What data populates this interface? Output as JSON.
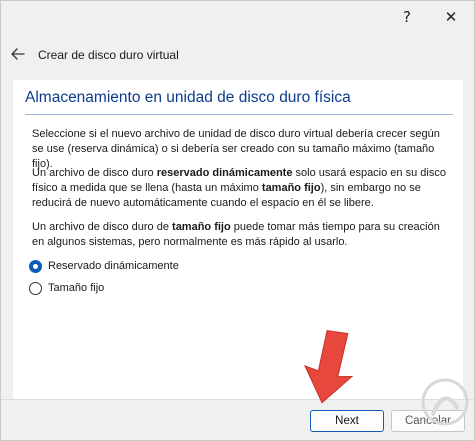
{
  "window": {
    "help_label": "?",
    "close_label": "✕"
  },
  "wizard": {
    "title": "Crear de disco duro virtual",
    "back_icon": "back-arrow-icon"
  },
  "page": {
    "title": "Almacenamiento en unidad de disco duro física",
    "paragraph1": "Seleccione si el nuevo archivo de unidad de disco duro virtual debería crecer según se use (reserva dinámica) o si debería ser creado con su tamaño máximo (tamaño fijo).",
    "paragraph2": {
      "a": "Un archivo de disco duro ",
      "b": "reservado dinámicamente",
      "c": " solo usará espacio en su disco físico a medida que se llena (hasta un máximo ",
      "d": "tamaño fijo",
      "e": "), sin embargo no se reducirá de nuevo automáticamente cuando el espacio en él se libere."
    },
    "paragraph3": {
      "a": "Un archivo de disco duro de ",
      "b": "tamaño fijo",
      "c": " puede tomar más tiempo para su creación en algunos sistemas, pero normalmente es más rápido al usarlo."
    },
    "options": [
      {
        "label": "Reservado dinámicamente",
        "selected": true
      },
      {
        "label": "Tamaño fijo",
        "selected": false
      }
    ]
  },
  "footer": {
    "next_label": "Next",
    "cancel_label": "Cancelar"
  },
  "colors": {
    "title_blue": "#0d3b8c",
    "accent": "#0f5bb5",
    "arrow_red": "#e8473d"
  }
}
